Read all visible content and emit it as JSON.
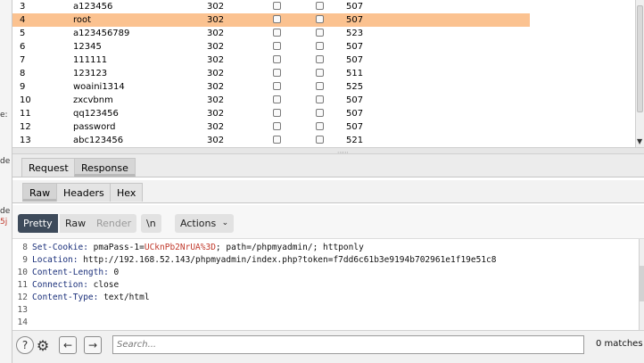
{
  "results": {
    "rows": [
      {
        "num": "3",
        "payload": "a123456",
        "status": "302",
        "length": "507",
        "selected": false
      },
      {
        "num": "4",
        "payload": "root",
        "status": "302",
        "length": "507",
        "selected": true
      },
      {
        "num": "5",
        "payload": "a123456789",
        "status": "302",
        "length": "523",
        "selected": false
      },
      {
        "num": "6",
        "payload": "12345",
        "status": "302",
        "length": "507",
        "selected": false
      },
      {
        "num": "7",
        "payload": "111111",
        "status": "302",
        "length": "507",
        "selected": false
      },
      {
        "num": "8",
        "payload": "123123",
        "status": "302",
        "length": "511",
        "selected": false
      },
      {
        "num": "9",
        "payload": "woaini1314",
        "status": "302",
        "length": "525",
        "selected": false
      },
      {
        "num": "10",
        "payload": "zxcvbnm",
        "status": "302",
        "length": "507",
        "selected": false
      },
      {
        "num": "11",
        "payload": "qq123456",
        "status": "302",
        "length": "507",
        "selected": false
      },
      {
        "num": "12",
        "payload": "password",
        "status": "302",
        "length": "507",
        "selected": false
      },
      {
        "num": "13",
        "payload": "abc123456",
        "status": "302",
        "length": "521",
        "selected": false
      }
    ]
  },
  "left_fragments": [
    "e:",
    "de",
    "de",
    "5j"
  ],
  "message_tabs": {
    "request": "Request",
    "response": "Response",
    "active": "Response"
  },
  "view_tabs": {
    "raw": "Raw",
    "headers": "Headers",
    "hex": "Hex",
    "active": "Raw"
  },
  "toolbar": {
    "pretty": "Pretty",
    "raw": "Raw",
    "render": "Render",
    "newline": "\\n",
    "actions": "Actions"
  },
  "editor": {
    "lines": [
      {
        "n": "8",
        "parts": [
          {
            "t": "Set-Cookie: ",
            "c": "k-blue"
          },
          {
            "t": "pmaPass-1=",
            "c": ""
          },
          {
            "t": "UCknPb2NrUA%3D",
            "c": "k-red"
          },
          {
            "t": "; path=/phpmyadmin/; httponly",
            "c": ""
          }
        ]
      },
      {
        "n": "9",
        "parts": [
          {
            "t": "Location: ",
            "c": "k-blue"
          },
          {
            "t": "http://192.168.52.143/phpmyadmin/index.php?token=f7dd6c61b3e9194b702961e1f19e51c8",
            "c": ""
          }
        ]
      },
      {
        "n": "10",
        "parts": [
          {
            "t": "Content-Length: ",
            "c": "k-blue"
          },
          {
            "t": "0",
            "c": ""
          }
        ]
      },
      {
        "n": "11",
        "parts": [
          {
            "t": "Connection: ",
            "c": "k-blue"
          },
          {
            "t": "close",
            "c": ""
          }
        ]
      },
      {
        "n": "12",
        "parts": [
          {
            "t": "Content-Type: ",
            "c": "k-blue"
          },
          {
            "t": "text/html",
            "c": ""
          }
        ]
      },
      {
        "n": "13",
        "parts": []
      },
      {
        "n": "14",
        "parts": []
      }
    ]
  },
  "bottom": {
    "help": "?",
    "search_placeholder": "Search...",
    "matches": "0 matches"
  }
}
